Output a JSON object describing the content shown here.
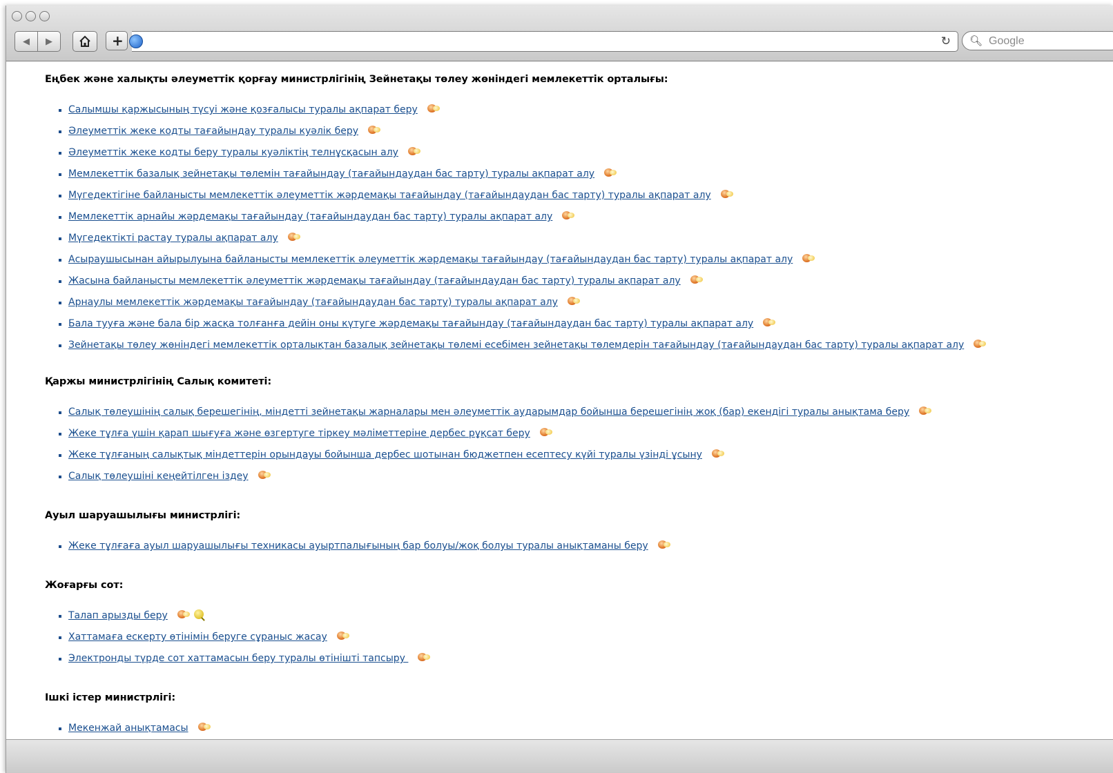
{
  "browser": {
    "search_placeholder": "Google",
    "icons": [
      "back-icon",
      "forward-icon",
      "home-icon",
      "add-bookmark-icon",
      "globe-icon",
      "reload-icon",
      "search-icon"
    ]
  },
  "sections": [
    {
      "heading": "Еңбек және халықты әлеуметтік қорғау министрлігінің Зейнетақы төлеу жөніндегі мемлекеттік орталығы:",
      "items": [
        {
          "label": "Салымшы қаржысының түсуі және қозғалысы туралы ақпарат беру"
        },
        {
          "label": "Әлеуметтік жеке кодты тағайындау туралы куәлік беру"
        },
        {
          "label": "Әлеуметтік жеке кодты беру туралы куәліктің телнұсқасын алу"
        },
        {
          "label": "Мемлекеттік базалық зейнетақы төлемін тағайындау (тағайындаудан бас тарту) туралы ақпарат алу"
        },
        {
          "label": "Мүгедектігіне байланысты мемлекеттік әлеуметтік жәрдемақы тағайындау (тағайындаудан бас тарту) туралы ақпарат алу"
        },
        {
          "label": "Мемлекеттік арнайы жәрдемақы тағайындау (тағайындаудан бас тарту) туралы ақпарат алу"
        },
        {
          "label": "Мүгедектікті растау туралы ақпарат алу"
        },
        {
          "label": "Асыраушысынан айырылуына байланысты мемлекеттік әлеуметтік жәрдемақы тағайындау (тағайындаудан бас тарту) туралы ақпарат алу"
        },
        {
          "label": "Жасына байланысты мемлекеттік әлеуметтік жәрдемақы тағайындау (тағайындаудан бас тарту) туралы ақпарат алу"
        },
        {
          "label": "Арнаулы мемлекеттік жәрдемақы тағайындау (тағайындаудан бас тарту) туралы ақпарат алу"
        },
        {
          "label": "Бала тууға және бала бір жасқа толғанға дейін оны күтуге жәрдемақы тағайындау (тағайындаудан бас тарту) туралы ақпарат алу"
        },
        {
          "label": "Зейнетақы төлеу жөніндегі мемлекеттік орталықтан базалық зейнетақы төлемі есебімен зейнетақы төлемдерін тағайындау (тағайындаудан бас тарту) туралы ақпарат алу"
        }
      ]
    },
    {
      "heading": "Қаржы министрлігінің Салық комитеті:",
      "items": [
        {
          "label": "Салық төлеушінің салық берешегінің, міндетті зейнетақы жарналары мен әлеуметтік аударымдар бойынша берешегінің жоқ (бар) екендігі туралы анықтама беру"
        },
        {
          "label": "Жеке тұлға үшін қарап шығуға және өзгертуге тіркеу мәліметтеріне дербес рұқсат беру"
        },
        {
          "label": "Жеке тұлғаның салықтық міндеттерін орындауы бойынша дербес шотынан бюджетпен есептесу күйі туралы үзінді ұсыну"
        },
        {
          "label": "Салық төлеушіні кеңейтілген іздеу"
        }
      ]
    },
    {
      "heading": "Ауыл шаруашылығы министрлігі:",
      "items": [
        {
          "label": "Жеке тұлғаға ауыл шаруашылығы техникасы ауыртпалығының бар болуы/жоқ болуы туралы анықтаманы беру"
        }
      ]
    },
    {
      "heading": "Жоғарғы сот:",
      "items": [
        {
          "label": "Талап арызды беру",
          "extra_icon": "search-help-icon"
        },
        {
          "label": "Хаттамаға ескерту өтінімін беруге сұраныс жасау"
        },
        {
          "label": "Электронды түрде сот хаттамасын беру туралы өтінішті тапсыру "
        }
      ]
    },
    {
      "heading": "Ішкі істер министрлігі:",
      "items": [
        {
          "label": "Мекенжай анықтамасы"
        }
      ]
    }
  ]
}
